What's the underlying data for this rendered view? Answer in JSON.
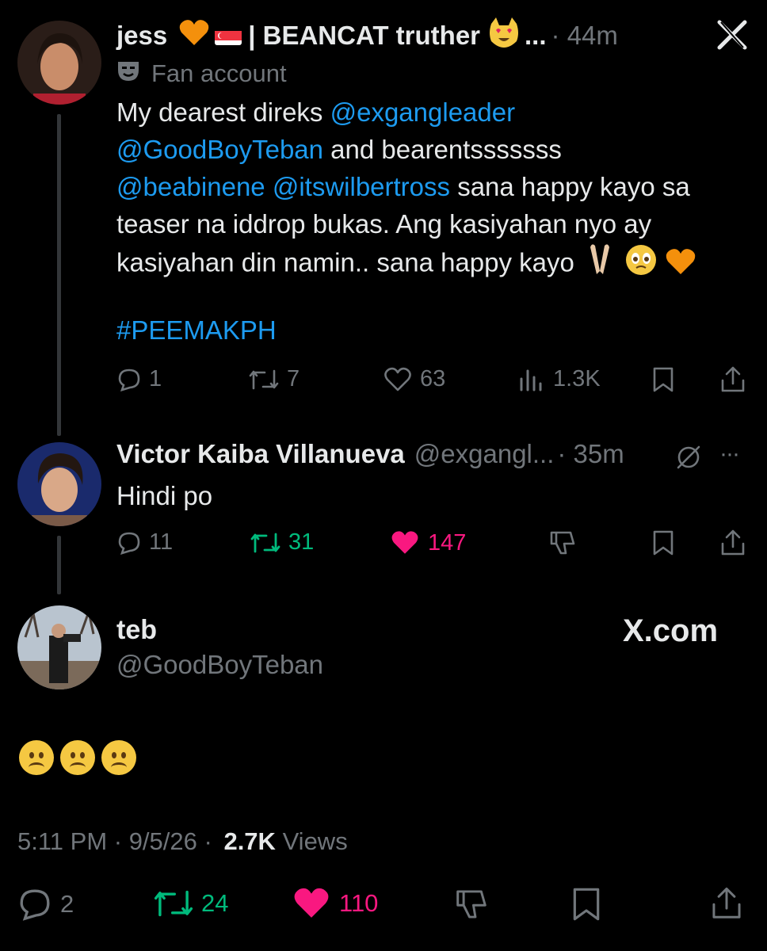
{
  "tweet1": {
    "display_name": "jess",
    "name_suffix": "| BEANCAT truther",
    "ellipsis": "...",
    "time": "· 44m",
    "badge_label": "Fan account",
    "text_lines": [
      {
        "parts": [
          {
            "t": "My dearest direks ",
            "link": false
          },
          {
            "t": "@exgangleader",
            "link": true
          }
        ]
      },
      {
        "parts": [
          {
            "t": "@GoodBoyTeban",
            "link": true
          },
          {
            "t": " and bearentsssssss",
            "link": false
          }
        ]
      },
      {
        "parts": [
          {
            "t": "@beabinene",
            "link": true
          },
          {
            "t": " ",
            "link": false
          },
          {
            "t": "@itswilbertross",
            "link": true
          },
          {
            "t": " sana happy kayo sa",
            "link": false
          }
        ]
      },
      {
        "parts": [
          {
            "t": "teaser na iddrop bukas. Ang kasiyahan nyo ay",
            "link": false
          }
        ]
      },
      {
        "parts": [
          {
            "t": "kasiyahan din namin.. sana happy kayo",
            "link": false
          }
        ]
      }
    ],
    "hashtag": "#PEEMAKPH",
    "replies": "1",
    "reposts": "7",
    "likes": "63",
    "views": "1.3K"
  },
  "tweet2": {
    "display_name": "Victor Kaiba Villanueva",
    "handle": "@exgangl...",
    "time": "· 35m",
    "more": "···",
    "text": "Hindi po",
    "replies": "11",
    "reposts": "31",
    "likes": "147"
  },
  "tweet3": {
    "display_name": "teb",
    "handle": "@GoodBoyTeban",
    "watermark": "X.com",
    "timestamp": "5:11 PM · 9/5/26 ·",
    "views_count": "2.7K",
    "views_label": "Views",
    "replies": "2",
    "reposts": "24",
    "likes": "110"
  },
  "colors": {
    "link": "#1d9bf0",
    "muted": "#71767b",
    "repost_active": "#00ba7c",
    "like_active": "#f91880"
  }
}
